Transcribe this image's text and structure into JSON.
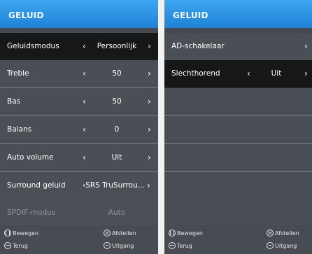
{
  "left_menu": {
    "title": "GELUID",
    "rows": [
      {
        "label": "Geluidsmodus",
        "value": "Persoonlijk"
      },
      {
        "label": "Treble",
        "value": "50"
      },
      {
        "label": "Bas",
        "value": "50"
      },
      {
        "label": "Balans",
        "value": "0"
      },
      {
        "label": "Auto volume",
        "value": "Uit"
      },
      {
        "label": "Surround geluid",
        "value": "SRS TruSurrou..."
      },
      {
        "label": "SPDIF-modus",
        "value": "Auto"
      }
    ],
    "hints": {
      "move": "Bewegen",
      "back": "Terug",
      "ok": "Afstellen",
      "exit": "Uitgang"
    }
  },
  "right_menu": {
    "title": "GELUID",
    "rows": [
      {
        "label": "AD-schakelaar",
        "value": ""
      },
      {
        "label": "Slechthorend",
        "value": "Uit"
      }
    ],
    "hints": {
      "move": "Bewegen",
      "back": "Terug",
      "ok": "Afstellen",
      "exit": "Uitgang"
    }
  },
  "glyphs": {
    "left_arrow": "‹",
    "right_arrow": "›"
  },
  "colors": {
    "header_blue": "#2a8fe0",
    "selected_row": "#161719",
    "panel_bg": "#4a4e55"
  }
}
